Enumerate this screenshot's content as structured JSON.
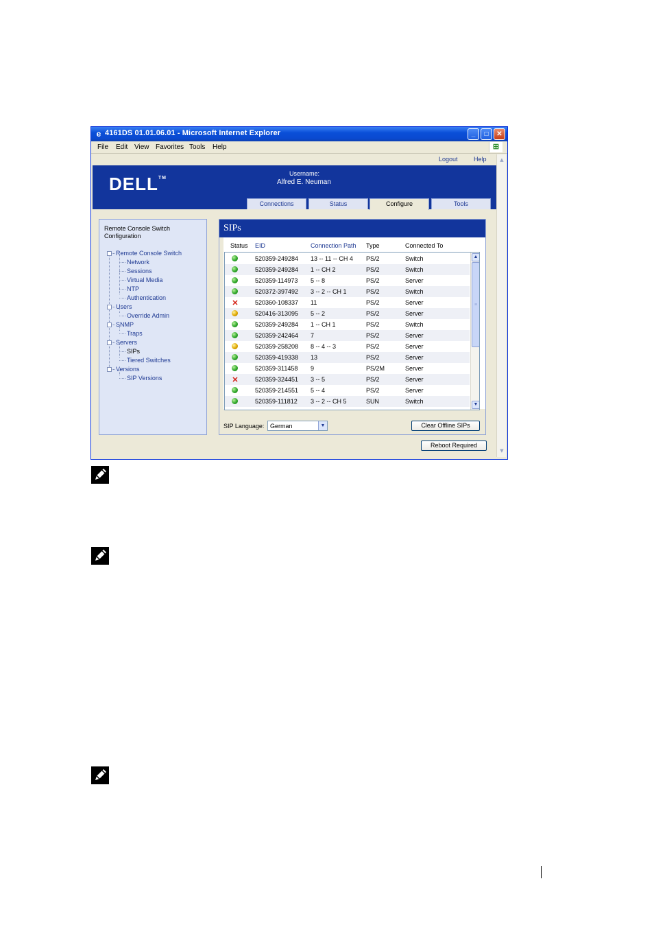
{
  "window": {
    "title": "4161DS 01.01.06.01 - Microsoft Internet Explorer",
    "controls": {
      "minimize": "_",
      "maximize": "□",
      "close": "✕"
    }
  },
  "menu": {
    "items": [
      "File",
      "Edit",
      "View",
      "Favorites",
      "Tools",
      "Help"
    ]
  },
  "toplinks": {
    "logout": "Logout",
    "help": "Help"
  },
  "header": {
    "logo": "DELL",
    "logo_tm": "TM",
    "username_label": "Username:",
    "username": "Alfred E. Neuman"
  },
  "tabs": [
    {
      "label": "Connections",
      "active": false
    },
    {
      "label": "Status",
      "active": false
    },
    {
      "label": "Configure",
      "active": true
    },
    {
      "label": "Tools",
      "active": false
    }
  ],
  "nav": {
    "heading": "Remote Console Switch Configuration",
    "groups": [
      {
        "label": "Remote Console Switch",
        "children": [
          "Network",
          "Sessions",
          "Virtual Media",
          "NTP",
          "Authentication"
        ]
      },
      {
        "label": "Users",
        "children": [
          "Override Admin"
        ]
      },
      {
        "label": "SNMP",
        "children": [
          "Traps"
        ]
      },
      {
        "label": "Servers",
        "children": [
          "SIPs",
          "Tiered Switches"
        ]
      },
      {
        "label": "Versions",
        "children": [
          "SIP Versions"
        ]
      }
    ]
  },
  "sips": {
    "title": "SIPs",
    "columns": [
      "Status",
      "EID",
      "Connection Path",
      "Type",
      "Connected To"
    ],
    "rows": [
      {
        "status": "online",
        "eid": "520359-249284",
        "path": "13 -- 11 -- CH 4",
        "type": "PS/2",
        "to": "Switch"
      },
      {
        "status": "online",
        "eid": "520359-249284",
        "path": "1 -- CH 2",
        "type": "PS/2",
        "to": "Switch"
      },
      {
        "status": "online",
        "eid": "520359-114973",
        "path": "5 -- 8",
        "type": "PS/2",
        "to": "Server"
      },
      {
        "status": "online",
        "eid": "520372-397492",
        "path": "3 -- 2 -- CH 1",
        "type": "PS/2",
        "to": "Switch"
      },
      {
        "status": "offline",
        "eid": "520360-108337",
        "path": "11",
        "type": "PS/2",
        "to": "Server"
      },
      {
        "status": "pending",
        "eid": "520416-313095",
        "path": "5 -- 2",
        "type": "PS/2",
        "to": "Server"
      },
      {
        "status": "online",
        "eid": "520359-249284",
        "path": "1 -- CH 1",
        "type": "PS/2",
        "to": "Switch"
      },
      {
        "status": "online",
        "eid": "520359-242464",
        "path": "7",
        "type": "PS/2",
        "to": "Server"
      },
      {
        "status": "pending",
        "eid": "520359-258208",
        "path": "8 -- 4 -- 3",
        "type": "PS/2",
        "to": "Server"
      },
      {
        "status": "online",
        "eid": "520359-419338",
        "path": "13",
        "type": "PS/2",
        "to": "Server"
      },
      {
        "status": "online",
        "eid": "520359-311458",
        "path": "9",
        "type": "PS/2M",
        "to": "Server"
      },
      {
        "status": "offline",
        "eid": "520359-324451",
        "path": "3 -- 5",
        "type": "PS/2",
        "to": "Server"
      },
      {
        "status": "online",
        "eid": "520359-214551",
        "path": "5 -- 4",
        "type": "PS/2",
        "to": "Server"
      },
      {
        "status": "online",
        "eid": "520359-111812",
        "path": "3 -- 2 -- CH 5",
        "type": "SUN",
        "to": "Switch"
      }
    ],
    "language_label": "SIP Language:",
    "language_value": "German",
    "clear_button": "Clear Offline SIPs"
  },
  "reboot_button": "Reboot Required",
  "colors": {
    "accent": "#12359c",
    "link": "#1f3a93",
    "online": "#2fa82a",
    "pending": "#e0a800",
    "offline": "#d41f14"
  },
  "icons": {
    "note": "pencil-note-icon"
  }
}
